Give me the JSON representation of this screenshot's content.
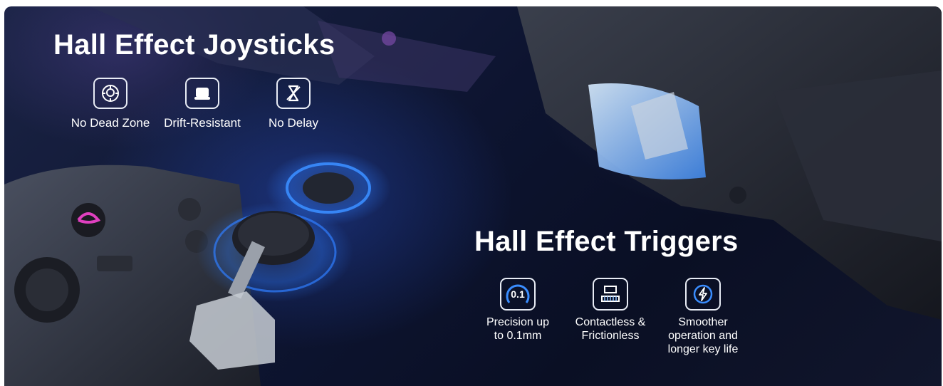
{
  "joysticks": {
    "title": "Hall Effect Joysticks",
    "features": [
      {
        "icon": "dead-zone-icon",
        "label": "No Dead Zone"
      },
      {
        "icon": "drift-resistant-icon",
        "label": "Drift-Resistant"
      },
      {
        "icon": "no-delay-icon",
        "label": "No Delay"
      }
    ]
  },
  "triggers": {
    "title": "Hall Effect Triggers",
    "features": [
      {
        "icon": "precision-icon",
        "icon_text": "0.1",
        "label": "Precision up\nto 0.1mm"
      },
      {
        "icon": "contactless-icon",
        "label": "Contactless &\nFrictionless"
      },
      {
        "icon": "lightning-icon",
        "label": "Smoother\noperation and\nlonger key life"
      }
    ]
  },
  "colors": {
    "background": "#0d1430",
    "glow_blue": "#2f7dff",
    "accent_pink": "#e040c0",
    "text": "#ffffff"
  }
}
